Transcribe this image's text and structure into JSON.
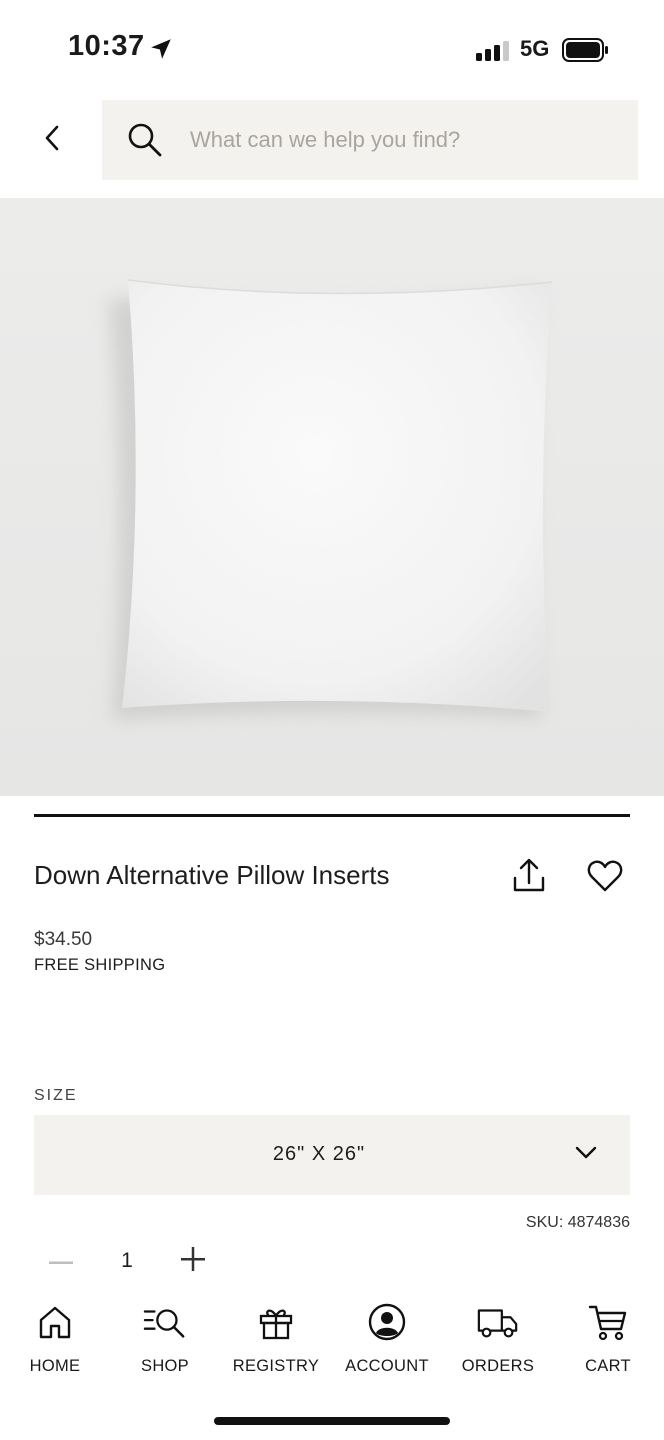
{
  "status_bar": {
    "time": "10:37",
    "network": "5G"
  },
  "header": {
    "search_placeholder": "What can we help you find?"
  },
  "product": {
    "title": "Down Alternative Pillow Inserts",
    "price": "$34.50",
    "shipping": "FREE SHIPPING",
    "size_label": "SIZE",
    "size_value": "26\" X 26\"",
    "sku": "SKU: 4874836",
    "quantity": "1"
  },
  "nav": {
    "items": [
      {
        "label": "HOME",
        "icon": "home-icon"
      },
      {
        "label": "SHOP",
        "icon": "shop-search-icon"
      },
      {
        "label": "REGISTRY",
        "icon": "gift-icon"
      },
      {
        "label": "ACCOUNT",
        "icon": "account-icon"
      },
      {
        "label": "ORDERS",
        "icon": "truck-icon"
      },
      {
        "label": "CART",
        "icon": "cart-icon"
      }
    ]
  },
  "colors": {
    "search_bg": "#f4f2ef",
    "text": "#1a1a1a",
    "placeholder": "#a9a49e"
  }
}
